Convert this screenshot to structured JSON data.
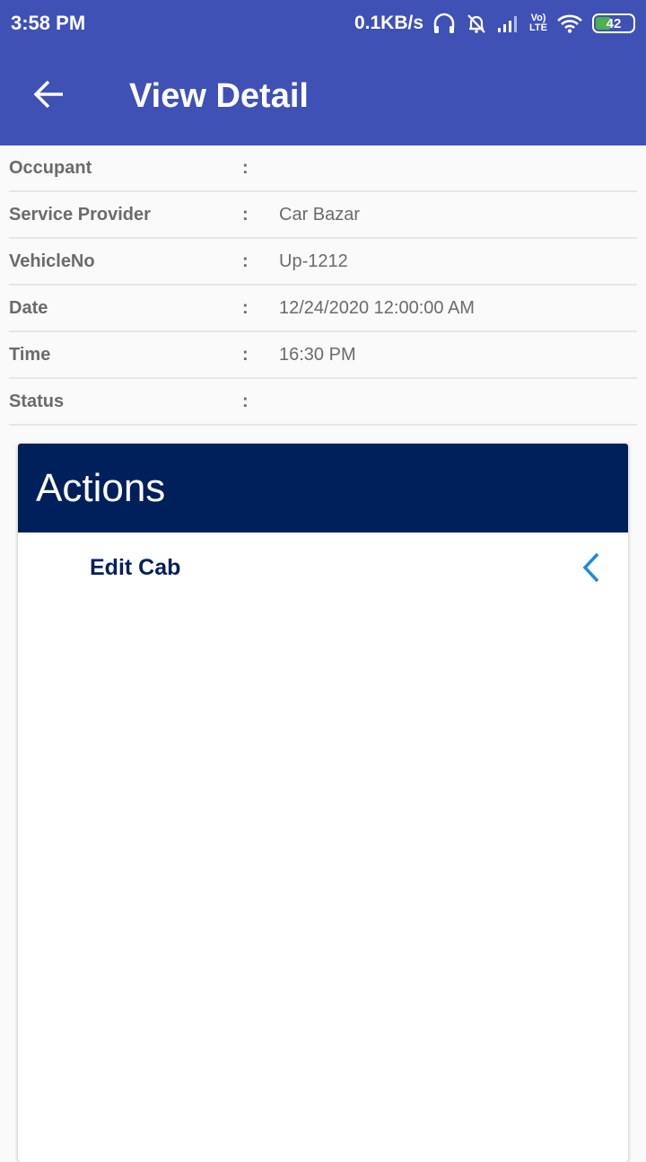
{
  "status_bar": {
    "time": "3:58 PM",
    "network_speed": "0.1KB/s",
    "volte_line1": "Vo)",
    "volte_line2": "LTE",
    "battery_level": "42",
    "battery_fraction": 0.42,
    "icons": [
      "headphones-icon",
      "muted-alarm-icon",
      "signal-icon",
      "volte-icon",
      "wifi-icon",
      "battery-icon"
    ]
  },
  "app_bar": {
    "title": "View Detail",
    "back_icon": "arrow-left-icon"
  },
  "details": [
    {
      "label": "Occupant",
      "separator": ":",
      "value": ""
    },
    {
      "label": "Service Provider",
      "separator": ":",
      "value": "Car Bazar"
    },
    {
      "label": "VehicleNo",
      "separator": ":",
      "value": "Up-1212"
    },
    {
      "label": "Date",
      "separator": ":",
      "value": "12/24/2020 12:00:00 AM"
    },
    {
      "label": "Time",
      "separator": ":",
      "value": "16:30 PM"
    },
    {
      "label": "Status",
      "separator": ":",
      "value": ""
    }
  ],
  "actions": {
    "title": "Actions",
    "items": [
      {
        "label": "Edit Cab",
        "icon": "chevron-left-icon"
      }
    ]
  },
  "colors": {
    "app_bar": "#3f51b5",
    "actions_header": "#00205b",
    "chevron": "#1e88e5",
    "label_text": "#6b6b6b"
  }
}
